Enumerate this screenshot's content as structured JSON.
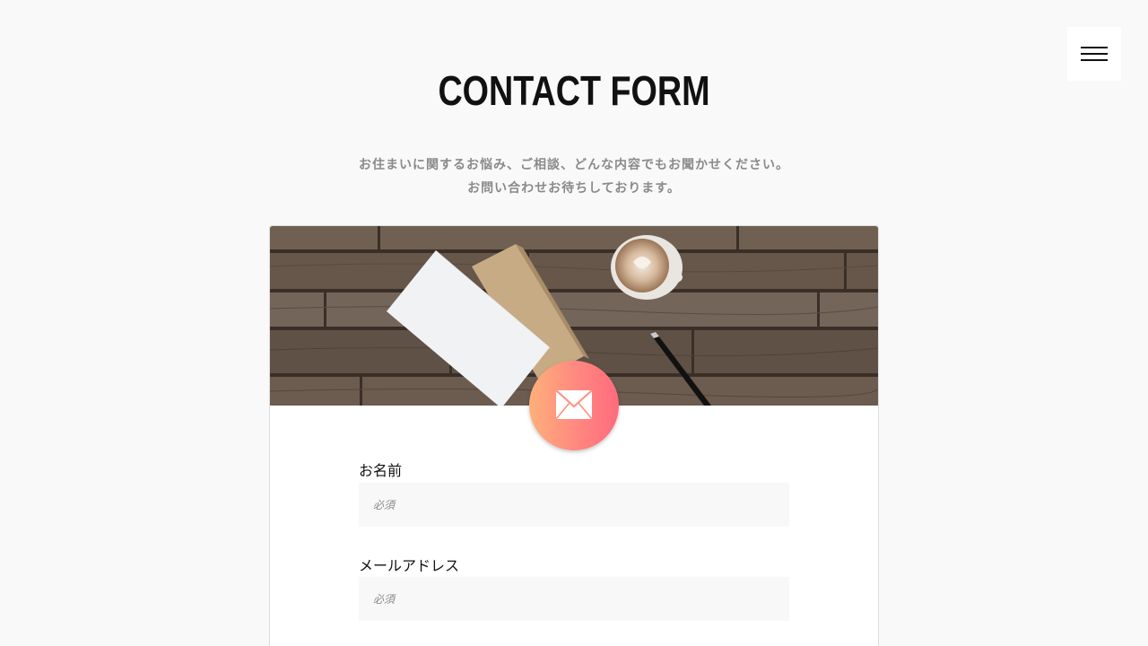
{
  "header": {
    "title": "CONTACT FORM",
    "lead_line1": "お住まいに関するお悩み、ご相談、どんな内容でもお聞かせください。",
    "lead_line2": "お問い合わせお待ちしております。"
  },
  "menu": {
    "icon": "hamburger-menu-icon"
  },
  "card": {
    "badge_icon": "envelope-icon",
    "badge_colors": [
      "#ffb07a",
      "#ff6b7d"
    ]
  },
  "form": {
    "name": {
      "label": "お名前",
      "placeholder": "必須",
      "value": ""
    },
    "email": {
      "label": "メールアドレス",
      "placeholder": "必須",
      "value": ""
    }
  }
}
